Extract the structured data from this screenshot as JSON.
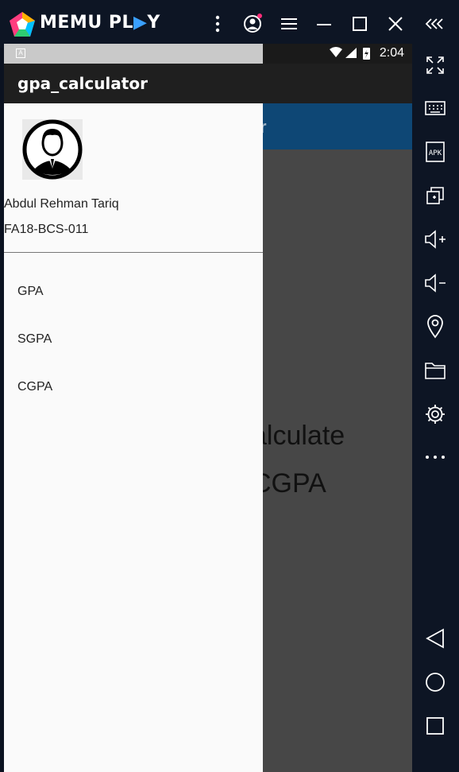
{
  "emulator": {
    "brand_left": "MEMU PL",
    "brand_accent": "▶",
    "brand_right": "Y",
    "titlebar_icons": [
      "more-vert-icon",
      "account-icon",
      "menu-icon",
      "minimize-icon",
      "maximize-icon",
      "close-icon",
      "collapse-icon"
    ],
    "sidebar_icons": [
      "fullscreen-icon",
      "keyboard-icon",
      "apk-icon",
      "multi-instance-icon",
      "volume-up-icon",
      "volume-down-icon",
      "location-icon",
      "folder-icon",
      "settings-icon",
      "more-horiz-icon",
      "back-icon",
      "home-icon",
      "recents-icon"
    ],
    "apk_label": "APK"
  },
  "status_bar": {
    "time": "2:04",
    "app_indicator": "A"
  },
  "app_bar": {
    "title": "gpa_calculator"
  },
  "background": {
    "header_fragment": "r",
    "text_line1": "alculate",
    "text_line2": "CGPA"
  },
  "drawer": {
    "user_name": "Abdul Rehman Tariq",
    "user_id": "FA18-BCS-011",
    "items": [
      {
        "label": "GPA"
      },
      {
        "label": "SGPA"
      },
      {
        "label": "CGPA"
      }
    ]
  },
  "colors": {
    "emulator_bg": "#0d1524",
    "app_bar": "#1f1f1f",
    "header_blue": "#0e4775",
    "drawer_bg": "#fafafa",
    "scrim": "#474747"
  }
}
